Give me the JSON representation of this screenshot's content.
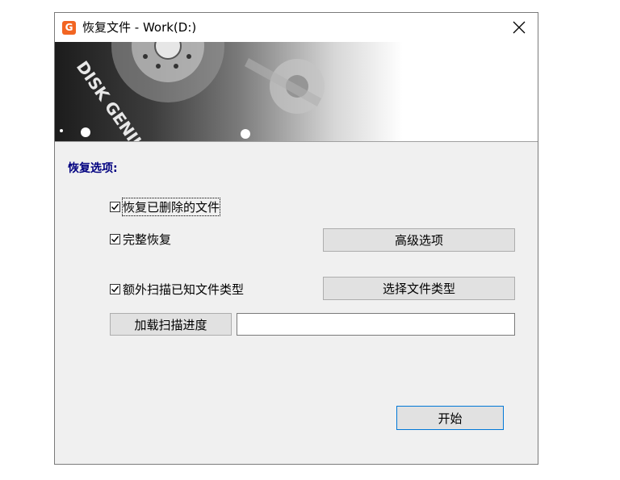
{
  "window": {
    "title": "恢复文件 - Work(D:)",
    "app_icon": "disk-genius-icon",
    "close_icon": "close-icon"
  },
  "banner": {
    "brand_text": "DISK GENIUS"
  },
  "options": {
    "section_title": "恢复选项:",
    "recover_deleted": {
      "label": "恢复已删除的文件",
      "checked": true
    },
    "full_recovery": {
      "label": "完整恢复",
      "checked": true
    },
    "extra_scan": {
      "label": "额外扫描已知文件类型",
      "checked": true
    }
  },
  "buttons": {
    "advanced": "高级选项",
    "select_types": "选择文件类型",
    "load_progress": "加载扫描进度",
    "start": "开始"
  },
  "progress_path": {
    "value": ""
  },
  "colors": {
    "section_title": "#000080",
    "icon": "#f26522",
    "focus": "#0078d7"
  }
}
